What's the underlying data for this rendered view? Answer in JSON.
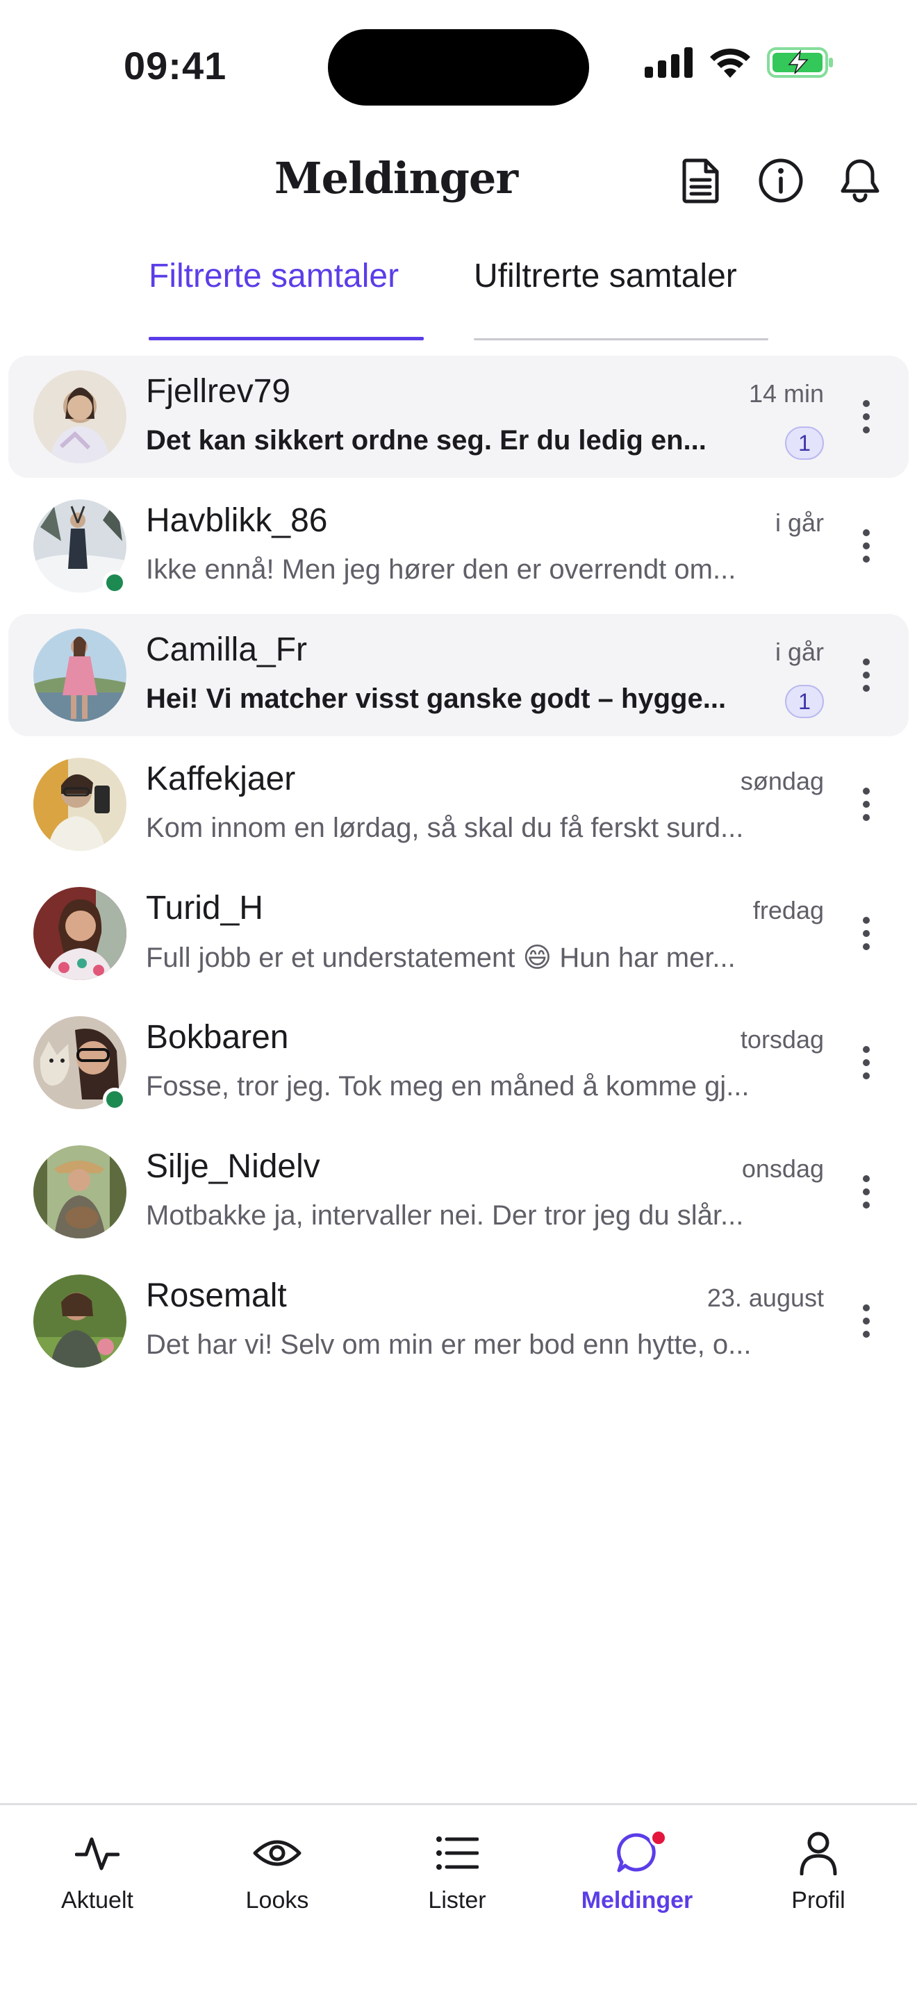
{
  "status_bar": {
    "time": "09:41"
  },
  "header": {
    "title": "Meldinger",
    "icons": [
      "document-icon",
      "info-icon",
      "bell-icon"
    ]
  },
  "tabs": [
    {
      "label": "Filtrerte samtaler",
      "active": true
    },
    {
      "label": "Ufiltrerte samtaler",
      "active": false
    }
  ],
  "conversations": [
    {
      "name": "Fjellrev79",
      "time": "14 min",
      "preview": "Det kan sikkert ordne seg. Er du ledig en...",
      "unread": true,
      "badge": "1",
      "online": false,
      "avatar_color": "#c9a98e"
    },
    {
      "name": "Havblikk_86",
      "time": "i går",
      "preview": "Ikke ennå! Men jeg hører den er overrendt om...",
      "unread": false,
      "badge": "",
      "online": true,
      "avatar_color": "#9aa6ad"
    },
    {
      "name": "Camilla_Fr",
      "time": "i går",
      "preview": "Hei! Vi matcher visst ganske godt – hygge...",
      "unread": true,
      "badge": "1",
      "online": false,
      "avatar_color": "#c98aa0"
    },
    {
      "name": "Kaffekjaer",
      "time": "søndag",
      "preview": "Kom innom en lørdag, så skal du få ferskt surd...",
      "unread": false,
      "badge": "",
      "online": false,
      "avatar_color": "#b8a27a"
    },
    {
      "name": "Turid_H",
      "time": "fredag",
      "preview": "Full jobb er et understatement 😄 Hun har mer...",
      "unread": false,
      "badge": "",
      "online": false,
      "avatar_color": "#8a4a42"
    },
    {
      "name": "Bokbaren",
      "time": "torsdag",
      "preview": "Fosse, tror jeg. Tok meg en måned å komme gj...",
      "unread": false,
      "badge": "",
      "online": true,
      "avatar_color": "#a88d7c"
    },
    {
      "name": "Silje_Nidelv",
      "time": "onsdag",
      "preview": "Motbakke ja, intervaller nei. Der tror jeg du slår...",
      "unread": false,
      "badge": "",
      "online": false,
      "avatar_color": "#7f8c5c"
    },
    {
      "name": "Rosemalt",
      "time": "23. august",
      "preview": "Det har vi! Selv om min er mer bod enn hytte, o...",
      "unread": false,
      "badge": "",
      "online": false,
      "avatar_color": "#6b8a4e"
    }
  ],
  "bottom_nav": [
    {
      "label": "Aktuelt",
      "icon": "activity-icon",
      "active": false
    },
    {
      "label": "Looks",
      "icon": "eye-icon",
      "active": false
    },
    {
      "label": "Lister",
      "icon": "list-icon",
      "active": false
    },
    {
      "label": "Meldinger",
      "icon": "chat-icon",
      "active": true,
      "notification": true
    },
    {
      "label": "Profil",
      "icon": "person-icon",
      "active": false
    }
  ],
  "colors": {
    "accent": "#5b3de8",
    "online": "#1d8a52",
    "notification": "#e3173e"
  }
}
